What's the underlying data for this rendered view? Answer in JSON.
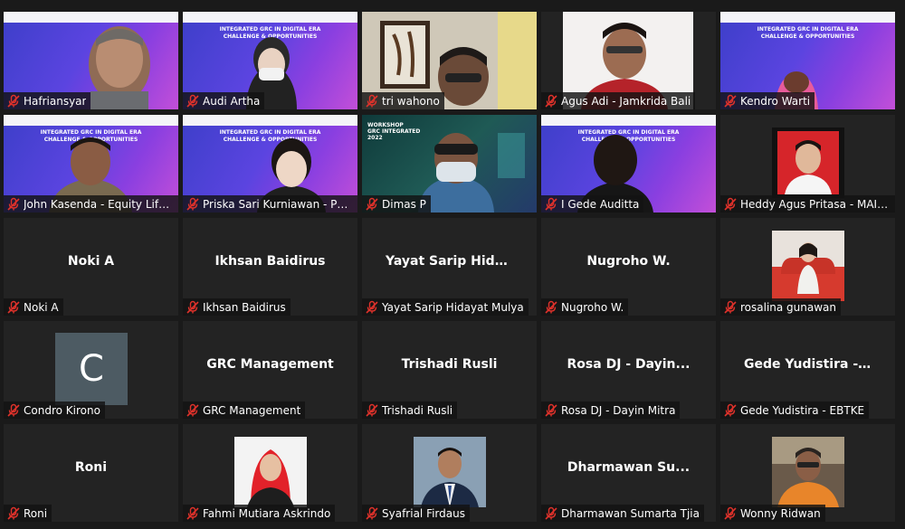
{
  "tiles": [
    {
      "name": "Hafriansyar",
      "type": "video",
      "bg": "banner"
    },
    {
      "name": "Audi Artha",
      "type": "video",
      "bg": "banner"
    },
    {
      "name": "tri wahono",
      "type": "video",
      "bg": "room"
    },
    {
      "name": "Agus Adi - Jamkrida Bali",
      "type": "video",
      "bg": "white"
    },
    {
      "name": "Kendro Warti",
      "type": "video",
      "bg": "banner"
    },
    {
      "name": "John Kasenda - Equity Life ...",
      "type": "video",
      "bg": "banner"
    },
    {
      "name": "Priska Sari Kurniawan - PT ...",
      "type": "video",
      "bg": "banner"
    },
    {
      "name": "Dimas P",
      "type": "video",
      "bg": "workshop"
    },
    {
      "name": "I Gede Auditta",
      "type": "video",
      "bg": "banner"
    },
    {
      "name": "Heddy Agus Pritasa - MAIP...",
      "type": "photo",
      "bg": "photo-red"
    },
    {
      "name": "Noki A",
      "center": "Noki A",
      "type": "text"
    },
    {
      "name": "Ikhsan Baidirus",
      "center": "Ikhsan Baidirus",
      "type": "text"
    },
    {
      "name": "Yayat Sarip Hidayat Mulya",
      "center": "Yayat  Sarip  Hida...",
      "type": "text"
    },
    {
      "name": "Nugroho W.",
      "center": "Nugroho W.",
      "type": "text"
    },
    {
      "name": "rosalina gunawan",
      "type": "photo",
      "bg": "photo-sofa"
    },
    {
      "name": "Condro Kirono",
      "avatar": "C",
      "type": "avatar"
    },
    {
      "name": "GRC Management",
      "center": "GRC Management",
      "type": "text"
    },
    {
      "name": "Trishadi Rusli",
      "center": "Trishadi Rusli",
      "type": "text"
    },
    {
      "name": "Rosa DJ - Dayin Mitra",
      "center": "Rosa DJ  -  Dayin...",
      "type": "text"
    },
    {
      "name": "Gede Yudistira - EBTKE",
      "center": "Gede  Yudistira  -...",
      "type": "text"
    },
    {
      "name": "Roni",
      "center": "Roni",
      "type": "text"
    },
    {
      "name": "Fahmi Mutiara Askrindo",
      "type": "photo",
      "bg": "photo-hijab"
    },
    {
      "name": "Syafrial Firdaus",
      "type": "photo",
      "bg": "photo-suit"
    },
    {
      "name": "Dharmawan Sumarta Tjia",
      "center": "Dharmawan  Su...",
      "type": "text"
    },
    {
      "name": "Wonny Ridwan",
      "type": "photo",
      "bg": "photo-outdoor"
    }
  ],
  "banner_text": "INTEGRATED GRC IN DIGITAL ERA CHALLENGE & OPPORTUNITIES",
  "colors": {
    "mic_muted": "#e0322b",
    "tile_bg": "#232323",
    "banner_start": "#3d3fc9",
    "banner_end": "#c34fd8"
  }
}
